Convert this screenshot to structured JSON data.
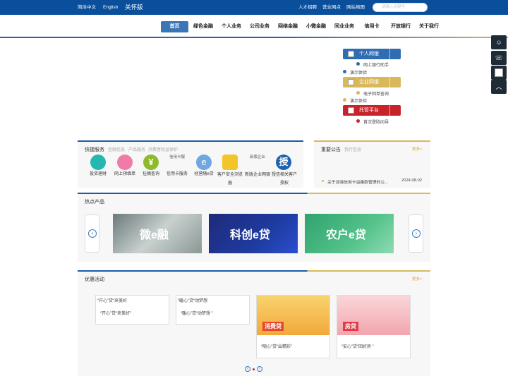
{
  "topbar": {
    "simplified": "简体中文",
    "english": "English",
    "care": "关怀版",
    "links": [
      "人才招聘",
      "营业网点",
      "网站地图"
    ],
    "search_placeholder": "请输入关键字"
  },
  "nav": {
    "items": [
      "首页",
      "绿色金融",
      "个人业务",
      "公司业务",
      "网络金融",
      "小微金融",
      "同业业务",
      "信用卡",
      "开放银行",
      "关于我行"
    ]
  },
  "side_services": {
    "personal": {
      "label": "个人网银",
      "links": [
        "网上银行助手",
        "演示体验"
      ]
    },
    "corporate": {
      "label": "企业网银",
      "links": [
        "电子回单查询",
        "演示体验"
      ]
    },
    "custody": {
      "label": "托管平台",
      "links": [
        "首次登陆向导"
      ]
    }
  },
  "quick": {
    "title": "快捷服务",
    "tabs": [
      "金融信息",
      "产品服务",
      "消费者权益保护"
    ],
    "items": [
      {
        "label": "投资理财",
        "icon": "invest-icon"
      },
      {
        "label": "网上预填单",
        "icon": "prefill-form-icon"
      },
      {
        "label": "挂摘查询",
        "icon": "yen-icon"
      },
      {
        "label": "信用卡服务",
        "icon": "credit-card-icon",
        "img_alt": "信用卡服"
      },
      {
        "label": "经营随e贷",
        "icon": "e-loan-icon"
      },
      {
        "label": "客户安全浏览器",
        "icon": "secure-browser-icon"
      },
      {
        "label": "新版企业网银",
        "icon": "corporate-ebank-icon",
        "img_alt": "新版企业"
      },
      {
        "label": "授信相关客户授权",
        "icon": "authorization-icon",
        "img_alt": "授"
      }
    ]
  },
  "notice": {
    "title": "重要公告",
    "tab": "我行信息",
    "more": "更多>",
    "items": [
      {
        "text": "关于加强信用卡溢缴款管理的公...",
        "date": "2024.08.02"
      }
    ]
  },
  "hot": {
    "title": "热点产品",
    "products": [
      "微e融",
      "科创e贷",
      "农户e贷"
    ]
  },
  "promo": {
    "title": "优惠活动",
    "more": "更多>",
    "cards": [
      {
        "img_alt": "“开心”贷“来美好",
        "caption": "“开心”贷“来美好”"
      },
      {
        "img_alt": "“暖心”贷“动梦想",
        "caption": "“暖心”贷“动梦想 ”"
      },
      {
        "img_tag": "消费贷",
        "caption": "“随心”贷“出精彩”"
      },
      {
        "img_tag": "房贷",
        "caption": "“安心”贷“回好房 ”"
      }
    ]
  },
  "colors": {
    "primary": "#0a4f9c",
    "nav_active": "#3a76b6",
    "gold": "#d9b85c",
    "red": "#c8222b"
  }
}
